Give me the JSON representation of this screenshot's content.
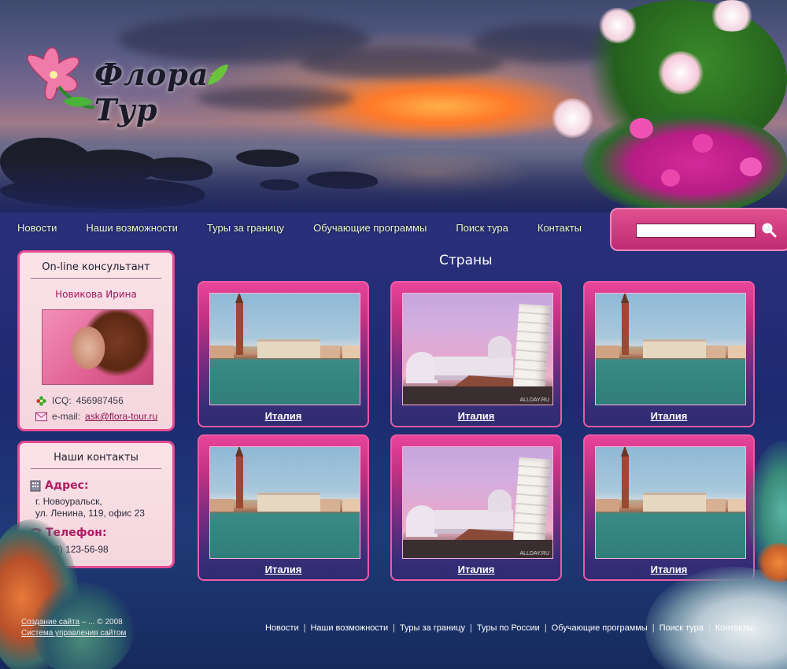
{
  "site": {
    "logo_text": "Флора-Тур"
  },
  "nav": {
    "items": [
      "Новости",
      "Наши возможности",
      "Туры за границу",
      "Обучающие программы",
      "Поиск тура",
      "Контакты"
    ]
  },
  "search": {
    "value": "",
    "placeholder": ""
  },
  "consultant": {
    "title": "On-line консультант",
    "name": "Новикова Ирина",
    "icq_label": "ICQ:",
    "icq_value": "456987456",
    "email_label": "e-mail:",
    "email_value": "ask@flora-tour.ru"
  },
  "contacts": {
    "title": "Наши контакты",
    "address_label": "Адрес:",
    "address_line1": "г. Новоуральск,",
    "address_line2": "ул. Ленина, 119, офис 23",
    "phone_label": "Телефон:",
    "phone_value": "(4568) 123-56-98"
  },
  "main": {
    "title": "Страны",
    "cards": [
      {
        "label": "Италия",
        "image": "venice"
      },
      {
        "label": "Италия",
        "image": "pisa"
      },
      {
        "label": "Италия",
        "image": "venice"
      },
      {
        "label": "Италия",
        "image": "venice"
      },
      {
        "label": "Италия",
        "image": "pisa"
      },
      {
        "label": "Италия",
        "image": "venice"
      }
    ],
    "watermark": "ALLDAY.RU"
  },
  "footer": {
    "create_link": "Создание сайта",
    "copyright_mid": " – ... © 2008",
    "cms_link": "Система управления сайтом",
    "nav": [
      "Новости",
      "Наши возможности",
      "Туры за границу",
      "Туры по России",
      "Обучающие программы",
      "Поиск тура",
      "Контакты"
    ]
  },
  "colors": {
    "accent_pink": "#e44d92",
    "background_blue": "#2a2f7a",
    "nav_text": "#e8f5c8"
  }
}
